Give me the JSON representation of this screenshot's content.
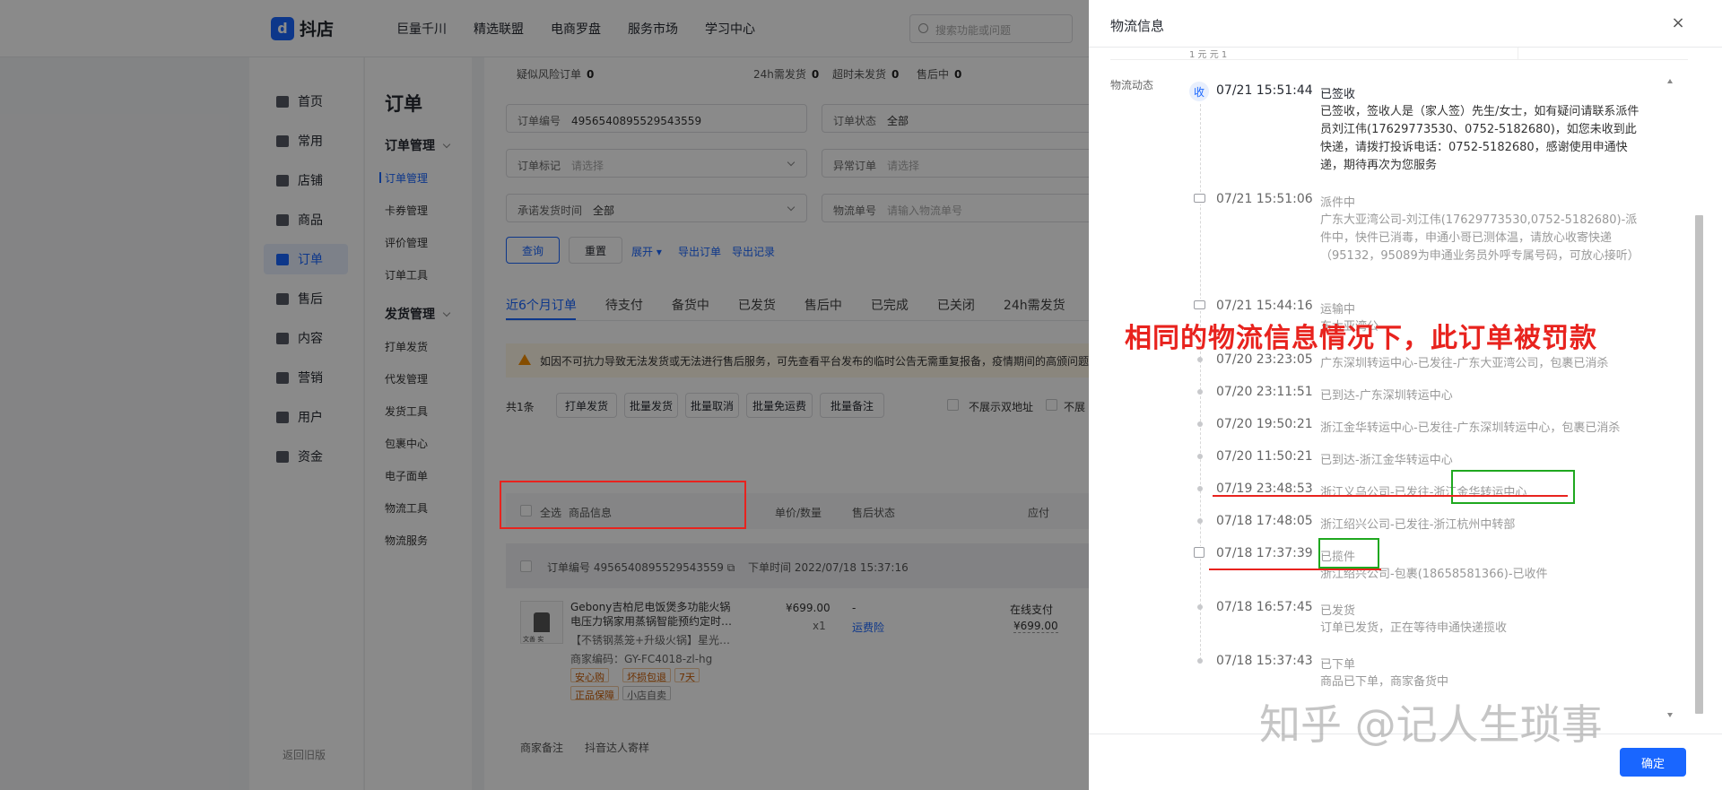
{
  "app": {
    "logo_mark": "d",
    "logo_text": "抖店"
  },
  "topnav": [
    "巨量千川",
    "精选联盟",
    "电商罗盘",
    "服务市场",
    "学习中心"
  ],
  "search": {
    "placeholder": "搜索功能或问题"
  },
  "sidebar": {
    "items": [
      {
        "label": "首页",
        "icon": "home-icon"
      },
      {
        "label": "常用",
        "icon": "grid-icon"
      },
      {
        "label": "店铺",
        "icon": "shop-icon"
      },
      {
        "label": "商品",
        "icon": "product-icon"
      },
      {
        "label": "订单",
        "icon": "order-icon",
        "active": true
      },
      {
        "label": "售后",
        "icon": "aftersale-icon"
      },
      {
        "label": "内容",
        "icon": "content-icon"
      },
      {
        "label": "营销",
        "icon": "marketing-icon"
      },
      {
        "label": "用户",
        "icon": "user-icon"
      },
      {
        "label": "资金",
        "icon": "money-icon"
      }
    ],
    "back_old": "返回旧版"
  },
  "subnav": {
    "title": "订单",
    "group1": "订单管理",
    "group1_items": [
      "订单管理",
      "卡券管理",
      "评价管理",
      "订单工具"
    ],
    "group2": "发货管理",
    "group2_items": [
      "打单发货",
      "代发管理",
      "发货工具",
      "包裹中心",
      "电子面单",
      "物流工具",
      "物流服务"
    ]
  },
  "main": {
    "stats": {
      "risk_label": "疑似风险订单",
      "risk_value": "0",
      "h24_label": "24h需发货",
      "h24_value": "0",
      "overdue_label": "超时未发货",
      "overdue_value": "0",
      "aftersale_label": "售后中",
      "aftersale_value": "0"
    },
    "filters": {
      "order_no_label": "订单编号",
      "order_no_value": "4956540895529543559",
      "order_status_label": "订单状态",
      "order_status_value": "全部",
      "order_mark_label": "订单标记",
      "order_mark_placeholder": "请选择",
      "abnormal_label": "异常订单",
      "abnormal_placeholder": "请选择",
      "ship_time_label": "承诺发货时间",
      "ship_time_value": "全部",
      "logistics_label": "物流单号",
      "logistics_placeholder": "请输入物流单号"
    },
    "buttons": {
      "query": "查询",
      "reset": "重置",
      "expand": "展开",
      "export_orders": "导出订单",
      "export_records": "导出记录"
    },
    "tabs": [
      "近6个月订单",
      "待支付",
      "备货中",
      "已发货",
      "售后中",
      "已完成",
      "已关闭",
      "24h需发货"
    ],
    "notice": "如因不可抗力导致无法发货或无法进行售后服务，可先查看平台发布的临时公告无需重复报备，疫情期间的高颁问题",
    "toolbar": {
      "count": "共1条",
      "buttons": [
        "打单发货",
        "批量发货",
        "批量取消",
        "批量免运费",
        "批量备注"
      ],
      "check1": "不展示双地址",
      "check2": "不展"
    },
    "table_headers": {
      "select_all": "全选",
      "product": "商品信息",
      "price_qty": "单价/数量",
      "after_sale": "售后状态",
      "due": "应付"
    },
    "order": {
      "order_no_label": "订单编号",
      "order_no": "4956540895529543559",
      "time_label": "下单时间",
      "time": "2022/07/18 15:37:16",
      "product_name": "Gebony吉柏尼电饭煲多功能火锅电压力锅家用蒸锅智能预约定时…",
      "spec": "【不锈钢蒸笼+升级火锅】星光…",
      "merchant_code": "商家编码：GY-FC4018-zl-hg",
      "tags": [
        "安心购",
        "坏损包退",
        "7天",
        "正品保障",
        "小店自卖"
      ],
      "price": "¥699.00",
      "qty": "x1",
      "after_sale": "-",
      "freight_insurance": "运费险",
      "pay_method": "在线支付",
      "pay_amount": "¥699.00",
      "thumb_text": "文善 实"
    },
    "footer_links": [
      "商家备注",
      "抖音达人寄样"
    ]
  },
  "drawer": {
    "title": "物流信息",
    "prev_snippet": "1 元 元 1",
    "flow_label": "物流动态",
    "events": [
      {
        "time": "07/21 15:51:44",
        "status": "已签收",
        "badge": "收",
        "detail": "已签收，签收人是（家人签）先生/女士，如有疑问请联系派件员刘江伟(17629773530、0752-5182680)，如您未收到此快递，请拨打投诉电话：0752-5182680，感谢使用申通快递，期待再次为您服务"
      },
      {
        "time": "07/21 15:51:06",
        "status": "派件中",
        "icon": "delivery-icon",
        "detail": "广东大亚湾公司-刘江伟(17629773530,0752-5182680)-派件中，快件已消毒，申通小哥已测体温，请放心收寄快递（95132，95089为申通业务员外呼专属号码，可放心接听）"
      },
      {
        "time": "07/21 15:44:16",
        "status": "运输中",
        "icon": "truck-icon",
        "detail": "东大亚湾公"
      },
      {
        "time": "07/20 23:23:05",
        "status": "广东深圳转运中心-已发往-广东大亚湾公司，包裹已消杀"
      },
      {
        "time": "07/20 23:11:51",
        "status": "已到达-广东深圳转运中心"
      },
      {
        "time": "07/20 19:50:21",
        "status": "浙江金华转运中心-已发往-广东深圳转运中心，包裹已消杀"
      },
      {
        "time": "07/20 11:50:21",
        "status": "已到达-浙江金华转运中心"
      },
      {
        "time": "07/19 23:48:53",
        "status": "浙江义乌公司-已发往-浙江金华转运中心"
      },
      {
        "time": "07/18 17:48:05",
        "status": "浙江绍兴公司-已发往-浙江杭州中转部"
      },
      {
        "time": "07/18 17:37:39",
        "status": "已揽件",
        "icon": "package-icon",
        "detail": "浙江绍兴公司-包裹(18658581366)-已收件"
      },
      {
        "time": "07/18 16:57:45",
        "status": "已发货",
        "detail": "订单已发货，正在等待申通快递揽收"
      },
      {
        "time": "07/18 15:37:43",
        "status": "已下单",
        "detail": "商品已下单，商家备货中"
      }
    ],
    "ok_button": "确定",
    "close": "×"
  },
  "annotation": {
    "text": "相同的物流信息情况下，此订单被罚款"
  },
  "watermark": "知乎 @记人生琐事",
  "colors": {
    "primary": "#1966ff",
    "annotation_red": "#e8231e",
    "annotation_green": "#1fa81f",
    "warning": "#f58f00"
  }
}
